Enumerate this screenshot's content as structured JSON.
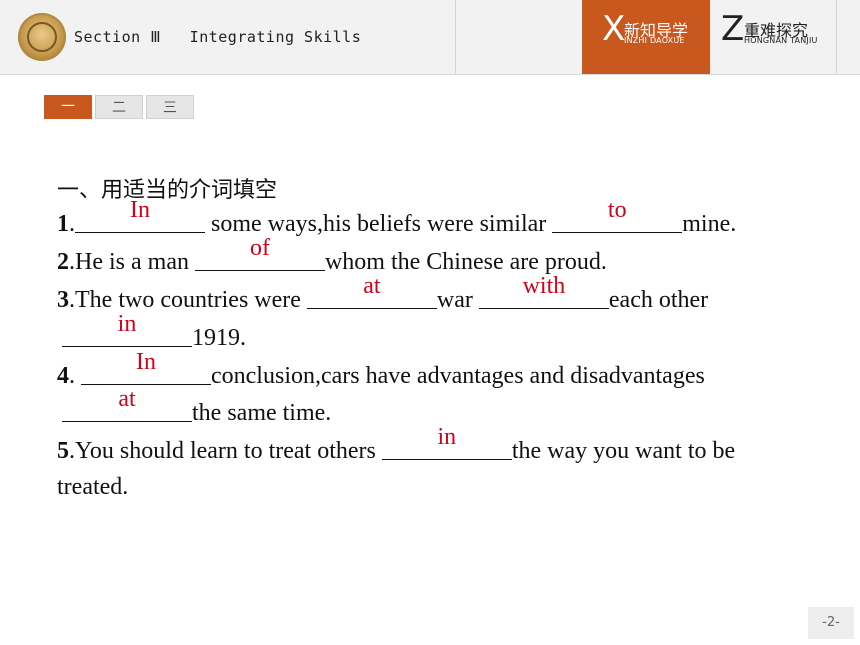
{
  "header": {
    "section_title": "Section Ⅲ   Integrating Skills",
    "tab_active": {
      "letter": "X",
      "cn": "新知导学",
      "pinyin": "INZHI DAOXUE"
    },
    "tab_inactive": {
      "letter": "Z",
      "cn": "重难探究",
      "pinyin": "HONGNAN TANJIU"
    }
  },
  "section_tabs": [
    "一",
    "二",
    "三"
  ],
  "heading": "一、用适当的介词填空",
  "items": {
    "q1": {
      "num": "1",
      "a": ".",
      "ans1": "In",
      "b": " some ways,his beliefs were similar ",
      "ans2": "to",
      "c": "mine."
    },
    "q2": {
      "num": "2",
      "a": ".He is a man ",
      "ans1": "of",
      "b": "whom the Chinese are proud."
    },
    "q3": {
      "num": "3",
      "a": ".The two countries were ",
      "ans1": "at",
      "b": "war ",
      "ans2": "with",
      "c": "each other",
      "ans3": "in",
      "d": "1919."
    },
    "q4": {
      "num": "4",
      "a": ". ",
      "ans1": "In",
      "b": "conclusion,cars have advantages and disadvantages",
      "ans2": "at",
      "c": "the same time."
    },
    "q5": {
      "num": "5",
      "a": ".You should learn to treat others ",
      "ans1": "in",
      "b": "the way you want to be",
      "c": "treated."
    }
  },
  "page_number": "-2-",
  "colors": {
    "accent": "#c8581e",
    "answer": "#d0021b"
  }
}
